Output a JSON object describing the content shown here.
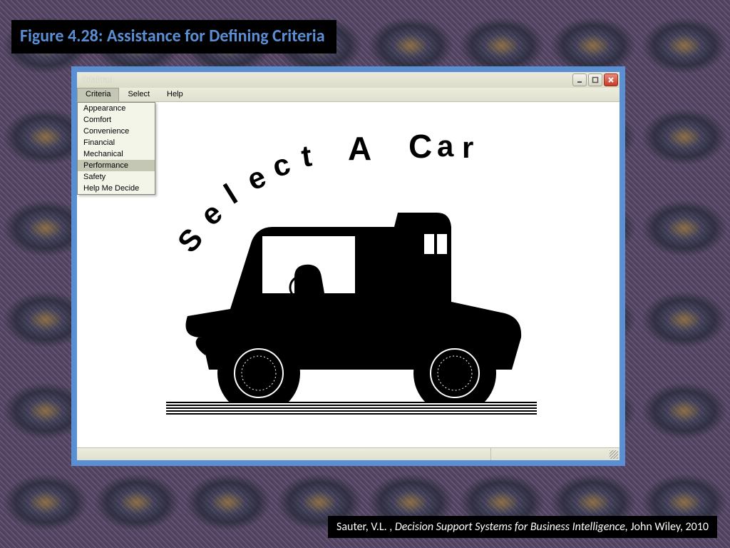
{
  "figure_label": "Figure 4.28:  Assistance for Defining Criteria",
  "citation": {
    "author": "Sauter, V.L. , ",
    "title_italic": "Decision Support Systems for Business Intelligence, ",
    "publisher": "John Wiley, 2010"
  },
  "window": {
    "title": "Odabran",
    "controls": {
      "minimize": "minimize",
      "maximize": "maximize",
      "close": "close"
    }
  },
  "menu": {
    "items": [
      {
        "label": "Criteria",
        "active": true
      },
      {
        "label": "Select",
        "active": false
      },
      {
        "label": "Help",
        "active": false
      }
    ]
  },
  "criteria_dropdown": {
    "items": [
      "Appearance",
      "Comfort",
      "Convenience",
      "Financial",
      "Mechanical",
      "Performance",
      "Safety",
      "Help Me Decide"
    ],
    "highlighted_index": 5
  },
  "content": {
    "headline_arc": "Select A Car"
  }
}
